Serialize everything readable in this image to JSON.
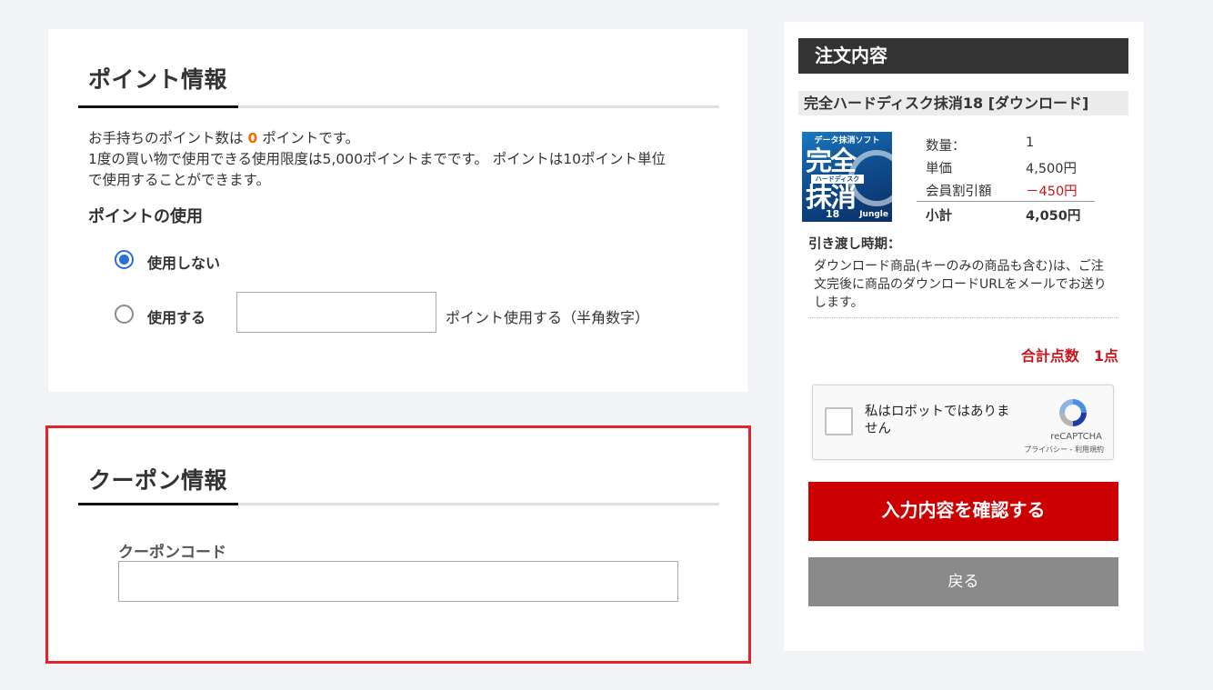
{
  "points": {
    "title": "ポイント情報",
    "line1_prefix": "お手持ちのポイント数は",
    "points_value": "0",
    "line1_suffix": "ポイントです。",
    "line2": "1度の買い物で使用できる使用限度は5,000ポイントまでです。 ポイントは10ポイント単位",
    "line3": "で使用することができます。",
    "usage_title": "ポイントの使用",
    "option_no": "使用しない",
    "option_yes": "使用する",
    "input_value": "",
    "hint": "ポイント使用する（半角数字）"
  },
  "coupon": {
    "title": "クーポン情報",
    "field_label": "クーポンコード",
    "input_value": ""
  },
  "order": {
    "title": "注文内容",
    "product_name": "完全ハードディスク抹消18 [ダウンロード]",
    "product_image": {
      "top": "データ抹消ソフト",
      "big1": "完全",
      "band": "ハードディスク",
      "big2": "抹消",
      "version": "18",
      "brand": "Jungle"
    },
    "rows": [
      {
        "label": "数量：",
        "value": "1"
      },
      {
        "label": "単価",
        "value": "4,500円"
      },
      {
        "label": "会員割引額",
        "value": "－450円"
      },
      {
        "label": "小計",
        "value": "4,050円"
      }
    ],
    "delivery_title": "引き渡し時期：",
    "delivery_text": "ダウンロード商品(キーのみの商品も含む)は、ご注文完後に商品のダウンロードURLをメールでお送りします。",
    "total_count": "合計点数　1点",
    "recaptcha": {
      "label": "私はロボットではありません",
      "brand": "reCAPTCHA",
      "links": "プライバシー - 利用規約"
    },
    "confirm_button": "入力内容を確認する",
    "back_button": "戻る"
  },
  "colors": {
    "accent_red": "#cc0000",
    "highlight_border": "#e3222a",
    "radio_blue": "#2b6fd6",
    "points_orange": "#ef6c00"
  }
}
